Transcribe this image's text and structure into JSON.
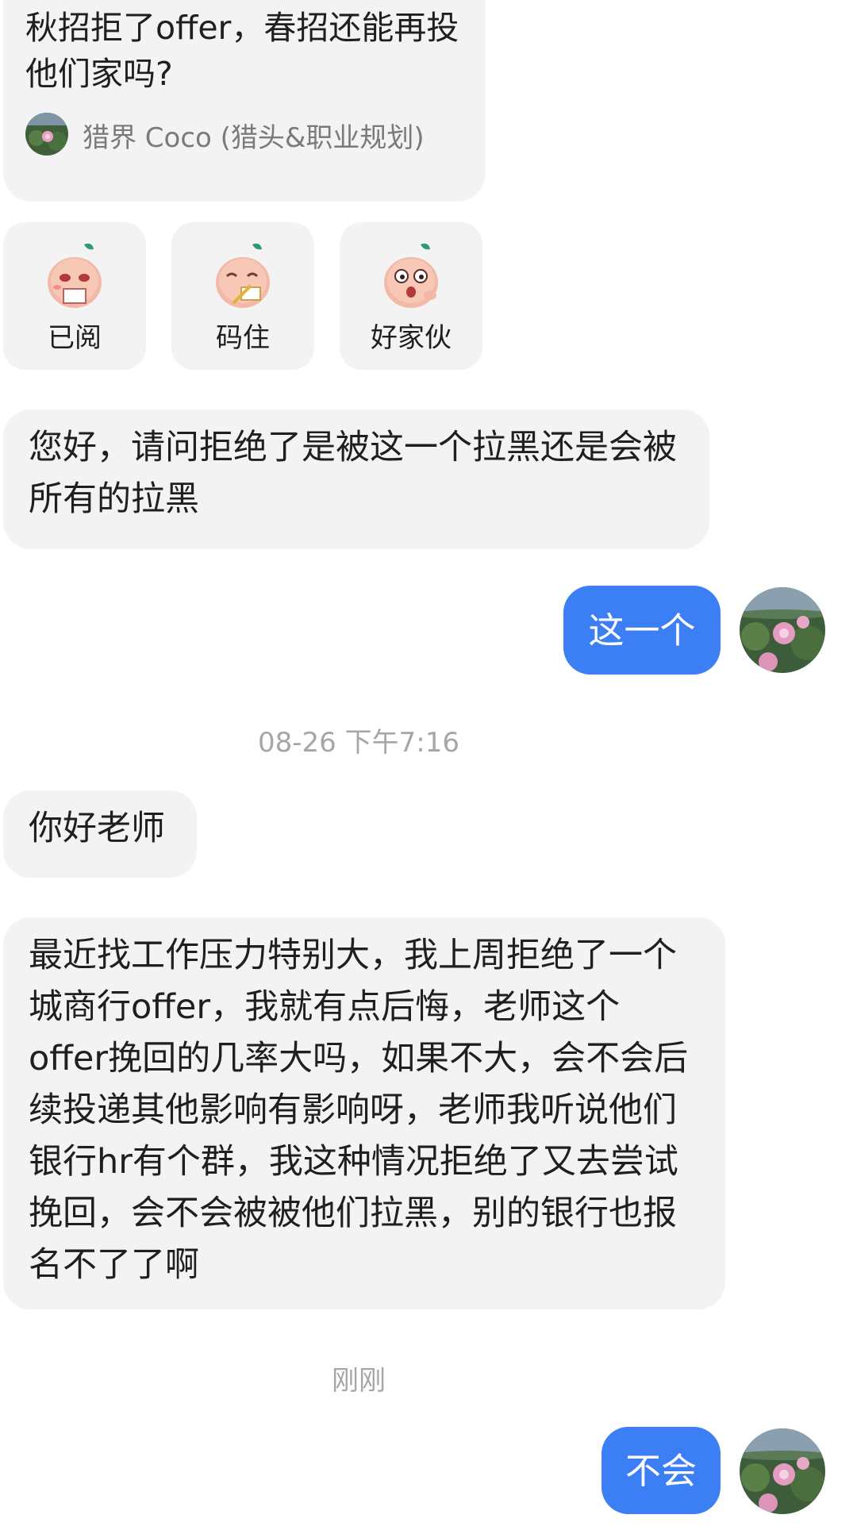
{
  "card": {
    "title": "秋招拒了offer，春招还能再投他们家吗?",
    "author": "猎界 Coco (猎头&职业规划)"
  },
  "stickers": [
    {
      "label": "已阅"
    },
    {
      "label": "码住"
    },
    {
      "label": "好家伙"
    }
  ],
  "messages": {
    "m1": "您好，请问拒绝了是被这一个拉黑还是会被所有的拉黑",
    "r1": "这一个",
    "time1": "08-26 下午7:16",
    "m2": "你好老师",
    "m3": "最近找工作压力特别大，我上周拒绝了一个城商行offer，我就有点后悔，老师这个offer挽回的几率大吗，如果不大，会不会后续投递其他影响有影响呀，老师我听说他们银行hr有个群，我这种情况拒绝了又去尝试挽回，会不会被被他们拉黑，别的银行也报名不了了啊",
    "time2": "刚刚",
    "r2": "不会"
  },
  "colors": {
    "bubble_left": "#f3f3f3",
    "bubble_right": "#3c7ff4",
    "timestamp": "#a6a6a6"
  }
}
